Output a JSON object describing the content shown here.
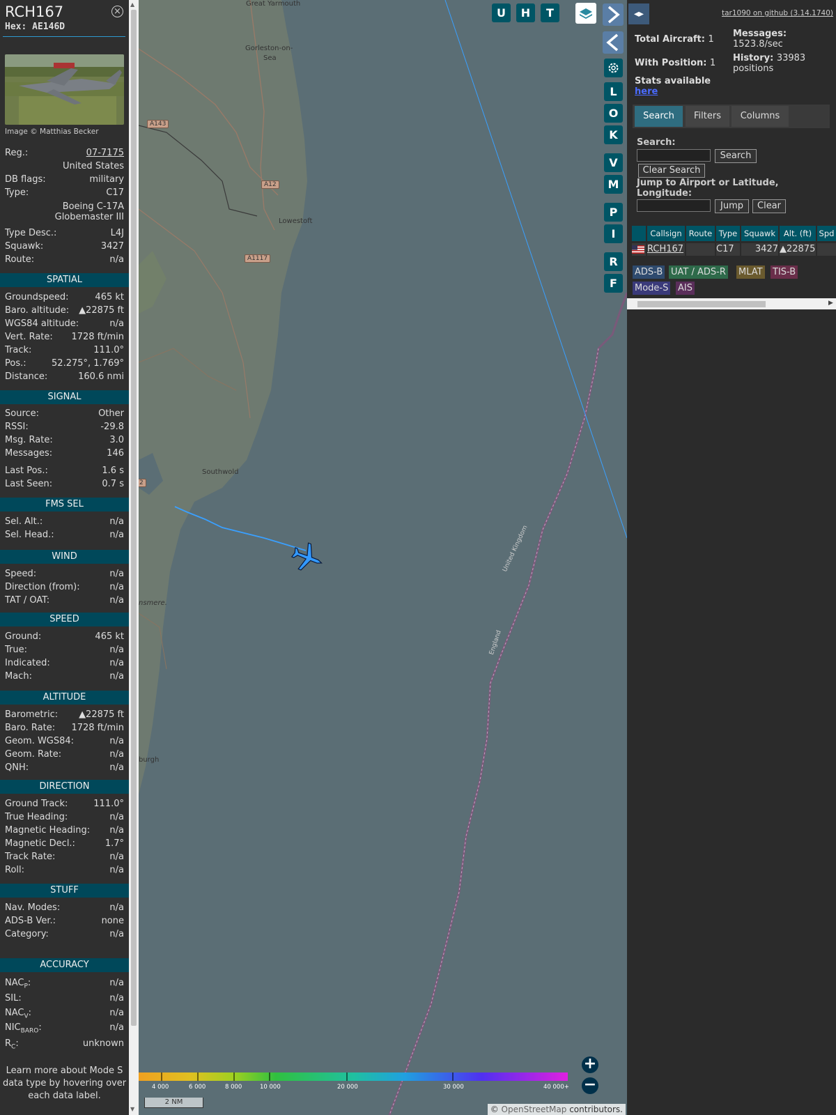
{
  "info": {
    "callsign": "RCH167",
    "hex": "Hex: AE146D",
    "close_icon": "×",
    "photo_credit": "Image © Matthias Becker",
    "fields": [
      {
        "k": "Reg.:",
        "v": "07-7175"
      },
      {
        "k": "",
        "v": "United States"
      },
      {
        "k": "DB flags:",
        "v": "military"
      },
      {
        "k": "Type:",
        "v": "C17"
      },
      {
        "k": "",
        "v": "Boeing C-17A"
      },
      {
        "k": "",
        "v": "Globemaster III"
      },
      {
        "k": "Type Desc.:",
        "v": "L4J"
      },
      {
        "k": "Squawk:",
        "v": "3427"
      },
      {
        "k": "Route:",
        "v": "n/a"
      }
    ],
    "spatial_title": "SPATIAL",
    "spatial": [
      {
        "k": "Groundspeed:",
        "v": "465 kt"
      },
      {
        "k": "Baro. altitude:",
        "v": "▲22875 ft"
      },
      {
        "k": "WGS84 altitude:",
        "v": "n/a"
      },
      {
        "k": "Vert. Rate:",
        "v": "1728 ft/min"
      },
      {
        "k": "Track:",
        "v": "111.0°"
      },
      {
        "k": "Pos.:",
        "v": "52.275°, 1.769°"
      },
      {
        "k": "Distance:",
        "v": "160.6 nmi"
      }
    ],
    "signal_title": "SIGNAL",
    "signal": [
      {
        "k": "Source:",
        "v": "Other"
      },
      {
        "k": "RSSI:",
        "v": "-29.8"
      },
      {
        "k": "Msg. Rate:",
        "v": "3.0"
      },
      {
        "k": "Messages:",
        "v": "146"
      },
      {
        "k": "Last Pos.:",
        "v": "1.6 s"
      },
      {
        "k": "Last Seen:",
        "v": "0.7 s"
      }
    ],
    "fms_title": "FMS SEL",
    "fms": [
      {
        "k": "Sel. Alt.:",
        "v": "n/a"
      },
      {
        "k": "Sel. Head.:",
        "v": "n/a"
      }
    ],
    "wind_title": "WIND",
    "wind": [
      {
        "k": "Speed:",
        "v": "n/a"
      },
      {
        "k": "Direction (from):",
        "v": "n/a"
      },
      {
        "k": "TAT / OAT:",
        "v": "n/a"
      }
    ],
    "speed_title": "SPEED",
    "speed": [
      {
        "k": "Ground:",
        "v": "465 kt"
      },
      {
        "k": "True:",
        "v": "n/a"
      },
      {
        "k": "Indicated:",
        "v": "n/a"
      },
      {
        "k": "Mach:",
        "v": "n/a"
      }
    ],
    "altitude_title": "ALTITUDE",
    "altitude": [
      {
        "k": "Barometric:",
        "v": "▲22875 ft"
      },
      {
        "k": "Baro. Rate:",
        "v": "1728 ft/min"
      },
      {
        "k": "Geom. WGS84:",
        "v": "n/a"
      },
      {
        "k": "Geom. Rate:",
        "v": "n/a"
      },
      {
        "k": "QNH:",
        "v": "n/a"
      }
    ],
    "direction_title": "DIRECTION",
    "direction": [
      {
        "k": "Ground Track:",
        "v": "111.0°"
      },
      {
        "k": "True Heading:",
        "v": "n/a"
      },
      {
        "k": "Magnetic Heading:",
        "v": "n/a"
      },
      {
        "k": "Magnetic Decl.:",
        "v": "1.7°"
      },
      {
        "k": "Track Rate:",
        "v": "n/a"
      },
      {
        "k": "Roll:",
        "v": "n/a"
      }
    ],
    "stuff_title": "STUFF",
    "stuff": [
      {
        "k": "Nav. Modes:",
        "v": "n/a"
      },
      {
        "k": "ADS-B Ver.:",
        "v": "none"
      },
      {
        "k": "Category:",
        "v": "n/a"
      }
    ],
    "accuracy_title": "ACCURACY",
    "accuracy": [
      {
        "k": "NAC",
        "sub": "P",
        "colon": ":",
        "v": "n/a"
      },
      {
        "k": "SIL:",
        "sub": "",
        "colon": "",
        "v": "n/a"
      },
      {
        "k": "NAC",
        "sub": "V",
        "colon": ":",
        "v": "n/a"
      },
      {
        "k": "NIC",
        "sub": "BARO",
        "colon": ":",
        "v": "n/a"
      },
      {
        "k": "R",
        "sub": "C",
        "colon": ":",
        "v": "unknown"
      }
    ],
    "note": "Learn more about Mode S data type by hovering over each data label."
  },
  "map": {
    "buttons_top": [
      "U",
      "H",
      "T"
    ],
    "buttons_side": [
      "L",
      "O",
      "K",
      "V",
      "M",
      "P",
      "I",
      "R",
      "F"
    ],
    "layers_icon": "layers-icon",
    "settings_icon": "gear-icon",
    "places": [
      "Great Yarmouth",
      "Gorleston-on-",
      "Sea",
      "Lowestoft",
      "Southwold",
      "burgh",
      "nsmere."
    ],
    "roads": [
      "A143",
      "A12",
      "A1117",
      "2"
    ],
    "border_labels": [
      "United Kingdom",
      "England"
    ],
    "alt_scale": [
      "4 000",
      "6 000",
      "8 000",
      "10 000",
      "20 000",
      "30 000",
      "40 000+"
    ],
    "scale": "2 NM",
    "attribution_pre": "© ",
    "attribution_osm": "OpenStreetMap",
    "attribution_post": " contributors.",
    "colors": {
      "sea": "#5b6e75",
      "land": "#6e7a70",
      "track": "#3aa0ff",
      "plane": "#3399ff"
    }
  },
  "right": {
    "toggle_icon": "◂▸",
    "github": "tar1090 on github (3.14.1740)",
    "total_aircraft_label": "Total Aircraft:",
    "total_aircraft": "1",
    "with_position_label": "With Position:",
    "with_position": "1",
    "messages_label": "Messages:",
    "messages": "1523.8/sec",
    "history_label": "History:",
    "history": "33983",
    "history_unit": "positions",
    "stats_label": "Stats available",
    "stats_link": "here",
    "tabs": [
      "Search",
      "Filters",
      "Columns"
    ],
    "search_label": "Search:",
    "search_button": "Search",
    "clear_search_button": "Clear Search",
    "jump_label": "Jump to Airport or Latitude, Longitude:",
    "jump_button": "Jump",
    "clear_button": "Clear",
    "columns": [
      "Callsign",
      "Route",
      "Type",
      "Squawk",
      "Alt. (ft)",
      "Spd"
    ],
    "row": {
      "callsign": "RCH167",
      "type": "C17",
      "squawk": "3427",
      "alt": "▲22875"
    },
    "chips": [
      {
        "label": "ADS-B",
        "color": "#2e4a6e"
      },
      {
        "label": "UAT / ADS-R",
        "color": "#2e6a4a"
      },
      {
        "label": "MLAT",
        "color": "#6a5a2e"
      },
      {
        "label": "TIS-B",
        "color": "#6a2e4a"
      },
      {
        "label": "Mode-S",
        "color": "#3a3a7a"
      },
      {
        "label": "AIS",
        "color": "#5a2e5a"
      }
    ]
  }
}
